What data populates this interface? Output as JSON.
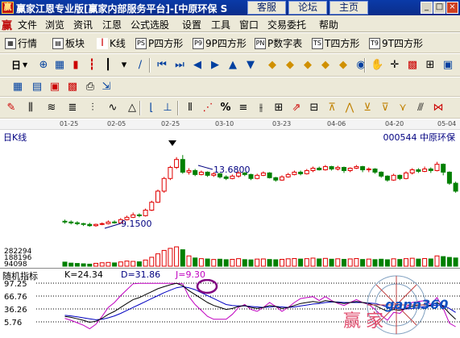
{
  "window": {
    "title": "赢家江恩专业版[赢家内部服务平台]-[中原环保 S",
    "buttons": [
      "客服",
      "论坛",
      "主页"
    ],
    "controls": [
      "_",
      "□",
      "×"
    ]
  },
  "menu": {
    "items": [
      "文件",
      "浏览",
      "资讯",
      "江恩",
      "公式选股",
      "设置",
      "工具",
      "窗口",
      "交易委托",
      "帮助"
    ]
  },
  "toolbar1": {
    "items": [
      {
        "icon": "grid-icon",
        "label": "行情"
      },
      {
        "icon": "blocks-icon",
        "label": "板块"
      },
      {
        "icon": "candles-icon",
        "label": "K线"
      },
      {
        "icon": "ps-icon",
        "badge": "PS",
        "label": "P四方形"
      },
      {
        "icon": "p9-icon",
        "badge": "P9",
        "label": "9P四方形"
      },
      {
        "icon": "pn-icon",
        "badge": "PN",
        "label": "P数字表"
      },
      {
        "icon": "ts-icon",
        "badge": "TS",
        "label": "T四方形"
      },
      {
        "icon": "t9-icon",
        "badge": "T9",
        "label": "9T四方形"
      }
    ]
  },
  "toolbar2": {
    "period": "日"
  },
  "chart": {
    "title": "日K线",
    "stock": "000544  中原环保",
    "dates": [
      "01-25",
      "02-05",
      "02-25",
      "03-10",
      "03-23",
      "04-06",
      "04-20",
      "05-04"
    ],
    "high_label": "13.6800",
    "low_label": "9.1500",
    "volume_labels": [
      "282294",
      "188196",
      "94098"
    ],
    "indicator": {
      "name": "随机指标",
      "k": "K=24.34",
      "d": "D=31.86",
      "j": "J=9.30",
      "yticks": [
        "97.25",
        "66.76",
        "36.26",
        "5.76"
      ]
    },
    "watermark": {
      "brand": "gann360",
      "text": "赢家"
    },
    "colors": {
      "up": "#e00000",
      "down": "#008000",
      "k_line": "#000000",
      "d_line": "#0000c0",
      "j_line": "#c000c0"
    }
  },
  "chart_data": {
    "type": "candlestick",
    "ylim": [
      8.8,
      14.2
    ],
    "candles": [
      {
        "o": 9.5,
        "c": 9.45,
        "h": 9.6,
        "l": 9.35
      },
      {
        "o": 9.45,
        "c": 9.4,
        "h": 9.55,
        "l": 9.3
      },
      {
        "o": 9.4,
        "c": 9.35,
        "h": 9.5,
        "l": 9.25
      },
      {
        "o": 9.35,
        "c": 9.3,
        "h": 9.4,
        "l": 9.2
      },
      {
        "o": 9.3,
        "c": 9.22,
        "h": 9.4,
        "l": 9.15
      },
      {
        "o": 9.22,
        "c": 9.3,
        "h": 9.35,
        "l": 9.15
      },
      {
        "o": 9.3,
        "c": 9.35,
        "h": 9.42,
        "l": 9.25
      },
      {
        "o": 9.35,
        "c": 9.45,
        "h": 9.55,
        "l": 9.3
      },
      {
        "o": 9.45,
        "c": 9.4,
        "h": 9.55,
        "l": 9.35
      },
      {
        "o": 9.4,
        "c": 9.6,
        "h": 9.7,
        "l": 9.38
      },
      {
        "o": 9.6,
        "c": 9.75,
        "h": 9.85,
        "l": 9.55
      },
      {
        "o": 9.75,
        "c": 9.9,
        "h": 10.05,
        "l": 9.7
      },
      {
        "o": 9.9,
        "c": 9.85,
        "h": 10.0,
        "l": 9.75
      },
      {
        "o": 9.85,
        "c": 10.2,
        "h": 10.3,
        "l": 9.8
      },
      {
        "o": 10.2,
        "c": 10.7,
        "h": 10.8,
        "l": 10.15
      },
      {
        "o": 10.7,
        "c": 11.4,
        "h": 11.5,
        "l": 10.65
      },
      {
        "o": 11.4,
        "c": 12.2,
        "h": 12.3,
        "l": 11.3
      },
      {
        "o": 12.2,
        "c": 12.9,
        "h": 13.0,
        "l": 12.1
      },
      {
        "o": 12.9,
        "c": 13.4,
        "h": 13.55,
        "l": 12.8
      },
      {
        "o": 13.4,
        "c": 12.6,
        "h": 13.68,
        "l": 12.5
      },
      {
        "o": 12.6,
        "c": 12.7,
        "h": 12.85,
        "l": 12.45
      },
      {
        "o": 12.7,
        "c": 12.45,
        "h": 12.8,
        "l": 12.35
      },
      {
        "o": 12.45,
        "c": 12.6,
        "h": 12.7,
        "l": 12.4
      },
      {
        "o": 12.6,
        "c": 12.4,
        "h": 12.65,
        "l": 12.3
      },
      {
        "o": 12.4,
        "c": 12.5,
        "h": 12.6,
        "l": 12.3
      },
      {
        "o": 12.5,
        "c": 12.3,
        "h": 12.55,
        "l": 12.2
      },
      {
        "o": 12.3,
        "c": 12.2,
        "h": 12.4,
        "l": 12.1
      },
      {
        "o": 12.2,
        "c": 12.35,
        "h": 12.45,
        "l": 12.15
      },
      {
        "o": 12.35,
        "c": 12.55,
        "h": 12.65,
        "l": 12.25
      },
      {
        "o": 12.55,
        "c": 12.45,
        "h": 12.6,
        "l": 12.35
      },
      {
        "o": 12.45,
        "c": 12.2,
        "h": 12.5,
        "l": 12.1
      },
      {
        "o": 12.2,
        "c": 12.4,
        "h": 12.5,
        "l": 12.15
      },
      {
        "o": 12.4,
        "c": 12.55,
        "h": 12.65,
        "l": 12.35
      },
      {
        "o": 12.55,
        "c": 12.25,
        "h": 12.6,
        "l": 12.2
      },
      {
        "o": 12.25,
        "c": 12.1,
        "h": 12.3,
        "l": 12.0
      },
      {
        "o": 12.1,
        "c": 12.3,
        "h": 12.4,
        "l": 12.05
      },
      {
        "o": 12.3,
        "c": 12.45,
        "h": 12.55,
        "l": 12.25
      },
      {
        "o": 12.45,
        "c": 12.6,
        "h": 12.7,
        "l": 12.4
      },
      {
        "o": 12.6,
        "c": 12.5,
        "h": 12.7,
        "l": 12.4
      },
      {
        "o": 12.5,
        "c": 12.7,
        "h": 12.8,
        "l": 12.45
      },
      {
        "o": 12.7,
        "c": 12.85,
        "h": 12.95,
        "l": 12.6
      },
      {
        "o": 12.85,
        "c": 12.75,
        "h": 12.95,
        "l": 12.7
      },
      {
        "o": 12.75,
        "c": 12.95,
        "h": 13.05,
        "l": 12.7
      },
      {
        "o": 12.95,
        "c": 12.8,
        "h": 13.0,
        "l": 12.7
      },
      {
        "o": 12.8,
        "c": 12.9,
        "h": 13.0,
        "l": 12.7
      },
      {
        "o": 12.9,
        "c": 12.7,
        "h": 12.95,
        "l": 12.55
      },
      {
        "o": 12.7,
        "c": 12.85,
        "h": 12.9,
        "l": 12.6
      },
      {
        "o": 12.85,
        "c": 12.95,
        "h": 13.05,
        "l": 12.8
      },
      {
        "o": 12.95,
        "c": 12.75,
        "h": 13.0,
        "l": 12.6
      },
      {
        "o": 12.75,
        "c": 12.8,
        "h": 12.9,
        "l": 12.6
      },
      {
        "o": 12.8,
        "c": 12.6,
        "h": 12.85,
        "l": 12.5
      },
      {
        "o": 12.6,
        "c": 12.35,
        "h": 12.65,
        "l": 12.25
      },
      {
        "o": 12.35,
        "c": 12.1,
        "h": 12.4,
        "l": 12.0
      },
      {
        "o": 12.1,
        "c": 12.4,
        "h": 12.5,
        "l": 12.05
      },
      {
        "o": 12.4,
        "c": 12.2,
        "h": 12.45,
        "l": 12.1
      },
      {
        "o": 12.2,
        "c": 12.55,
        "h": 12.65,
        "l": 12.15
      },
      {
        "o": 12.55,
        "c": 12.75,
        "h": 12.85,
        "l": 12.45
      },
      {
        "o": 12.75,
        "c": 12.65,
        "h": 12.85,
        "l": 12.55
      },
      {
        "o": 12.65,
        "c": 12.8,
        "h": 12.95,
        "l": 12.6
      },
      {
        "o": 12.8,
        "c": 12.7,
        "h": 12.9,
        "l": 12.55
      },
      {
        "o": 12.7,
        "c": 13.1,
        "h": 13.25,
        "l": 12.65
      },
      {
        "o": 13.1,
        "c": 12.6,
        "h": 13.15,
        "l": 12.4
      },
      {
        "o": 12.6,
        "c": 11.9,
        "h": 12.65,
        "l": 11.8
      },
      {
        "o": 11.9,
        "c": 11.4,
        "h": 12.0,
        "l": 11.3
      }
    ],
    "volume": [
      60,
      45,
      40,
      35,
      30,
      42,
      50,
      55,
      48,
      62,
      75,
      70,
      64,
      90,
      130,
      180,
      230,
      260,
      282,
      240,
      150,
      120,
      110,
      105,
      98,
      102,
      95,
      100,
      110,
      96,
      92,
      104,
      106,
      98,
      94,
      100,
      108,
      112,
      104,
      110,
      118,
      106,
      114,
      102,
      108,
      100,
      106,
      112,
      98,
      104,
      96,
      102,
      94,
      108,
      98,
      110,
      116,
      104,
      112,
      106,
      150,
      140,
      128,
      120
    ],
    "kdj": {
      "k": [
        30,
        28,
        25,
        22,
        18,
        20,
        26,
        34,
        40,
        48,
        56,
        64,
        68,
        74,
        80,
        86,
        90,
        94,
        97,
        92,
        82,
        74,
        66,
        58,
        52,
        48,
        44,
        46,
        50,
        52,
        48,
        46,
        48,
        52,
        50,
        46,
        48,
        52,
        56,
        58,
        60,
        58,
        62,
        60,
        58,
        56,
        58,
        60,
        58,
        56,
        52,
        46,
        40,
        44,
        42,
        46,
        50,
        52,
        54,
        52,
        58,
        50,
        36,
        24
      ],
      "d": [
        32,
        31,
        29,
        27,
        25,
        23,
        24,
        27,
        31,
        36,
        42,
        48,
        54,
        60,
        66,
        72,
        78,
        83,
        88,
        90,
        88,
        84,
        78,
        72,
        66,
        60,
        54,
        52,
        51,
        51,
        50,
        49,
        48,
        49,
        50,
        49,
        48,
        49,
        51,
        53,
        55,
        56,
        58,
        59,
        59,
        58,
        58,
        58,
        58,
        57,
        56,
        53,
        49,
        47,
        45,
        45,
        46,
        48,
        50,
        51,
        53,
        52,
        46,
        38
      ],
      "j": [
        26,
        22,
        17,
        12,
        5,
        14,
        30,
        48,
        58,
        72,
        84,
        96,
        97,
        97,
        97,
        97,
        97,
        97,
        97,
        96,
        70,
        54,
        42,
        30,
        24,
        24,
        24,
        34,
        48,
        54,
        44,
        40,
        48,
        58,
        50,
        40,
        48,
        58,
        66,
        68,
        70,
        62,
        70,
        62,
        56,
        52,
        58,
        64,
        58,
        54,
        44,
        32,
        22,
        38,
        36,
        48,
        58,
        60,
        62,
        54,
        68,
        46,
        16,
        9
      ]
    }
  }
}
